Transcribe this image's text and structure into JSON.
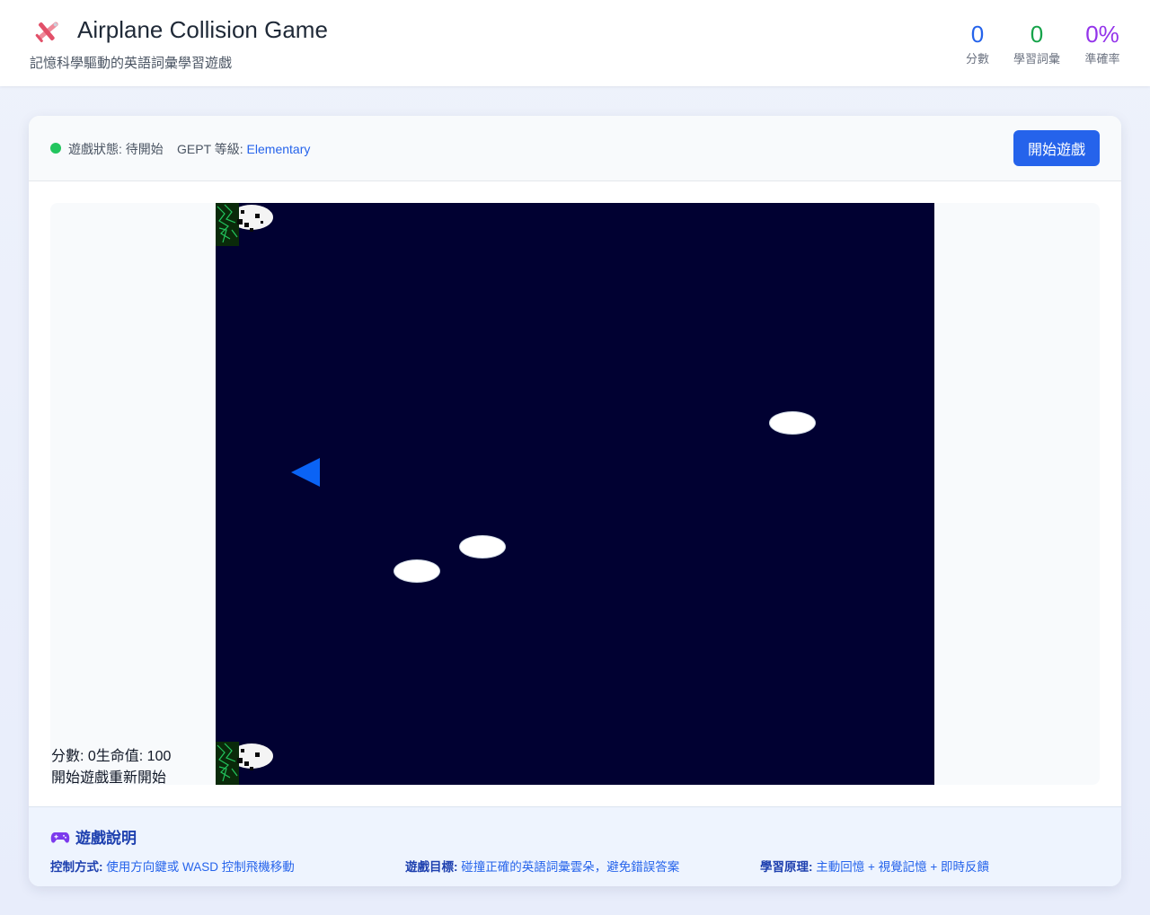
{
  "header": {
    "brand_icon": "airplane-icon",
    "title": "Airplane Collision Game",
    "subtitle": "記憶科學驅動的英語詞彙學習遊戲",
    "stats": [
      {
        "value": "0",
        "label": "分數",
        "color": "#2563eb"
      },
      {
        "value": "0",
        "label": "學習詞彙",
        "color": "#16a34a"
      },
      {
        "value": "0%",
        "label": "準確率",
        "color": "#9333ea"
      }
    ]
  },
  "toolbar": {
    "status_label": "遊戲狀態:",
    "status_value": "待開始",
    "status_color": "#22c55e",
    "level_label": "GEPT 等級:",
    "level_value": "Elementary",
    "start_button": "開始遊戲",
    "accent_color": "#2563eb"
  },
  "game": {
    "background_color": "#010132",
    "player_color": "#0a63f5",
    "clouds_count": 3,
    "overlay_stats": "分數: 0生命值: 100",
    "overlay_controls": "開始遊戲重新開始"
  },
  "instructions": {
    "icon": "gamepad-icon",
    "title": "遊戲說明",
    "items": [
      {
        "label": "控制方式:",
        "text": "使用方向鍵或 WASD 控制飛機移動"
      },
      {
        "label": "遊戲目標:",
        "text": "碰撞正確的英語詞彙雲朵，避免錯誤答案"
      },
      {
        "label": "學習原理:",
        "text": "主動回憶 + 視覺記憶 + 即時反饋"
      }
    ]
  }
}
